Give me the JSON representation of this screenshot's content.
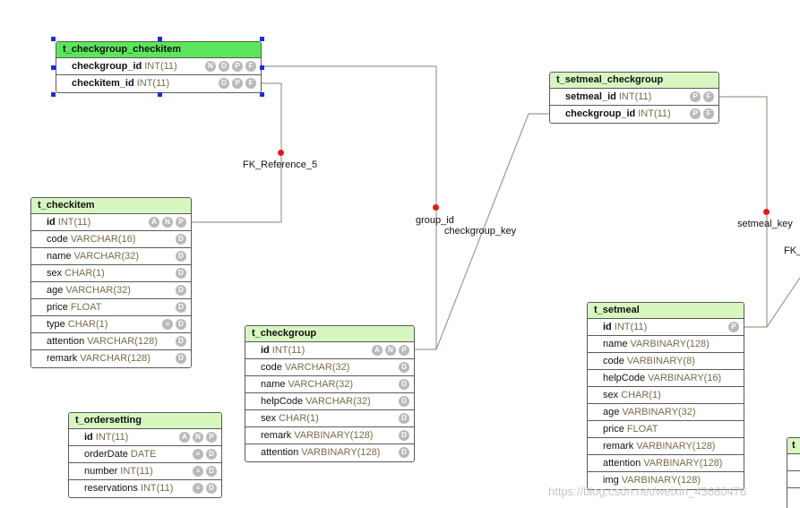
{
  "tables": {
    "checkgroup_checkitem": {
      "name": "t_checkgroup_checkitem",
      "columns": [
        {
          "name": "checkgroup_id",
          "type": "INT(11)",
          "pk": true,
          "flags": [
            "N",
            "D",
            "P",
            "F"
          ]
        },
        {
          "name": "checkitem_id",
          "type": "INT(11)",
          "pk": true,
          "flags": [
            "D",
            "P",
            "F"
          ]
        }
      ]
    },
    "setmeal_checkgroup": {
      "name": "t_setmeal_checkgroup",
      "columns": [
        {
          "name": "setmeal_id",
          "type": "INT(11)",
          "pk": true,
          "flags": [
            "P",
            "F"
          ]
        },
        {
          "name": "checkgroup_id",
          "type": "INT(11)",
          "pk": true,
          "flags": [
            "P",
            "F"
          ]
        }
      ]
    },
    "checkitem": {
      "name": "t_checkitem",
      "columns": [
        {
          "name": "id",
          "type": "INT(11)",
          "pk": true,
          "flags": [
            "A",
            "N",
            "P"
          ]
        },
        {
          "name": "code",
          "type": "VARCHAR(16)",
          "pk": false,
          "flags": [
            "D"
          ]
        },
        {
          "name": "name",
          "type": "VARCHAR(32)",
          "pk": false,
          "flags": [
            "D"
          ]
        },
        {
          "name": "sex",
          "type": "CHAR(1)",
          "pk": false,
          "flags": [
            "D"
          ]
        },
        {
          "name": "age",
          "type": "VARCHAR(32)",
          "pk": false,
          "flags": [
            "D"
          ]
        },
        {
          "name": "price",
          "type": "FLOAT",
          "pk": false,
          "flags": [
            "D"
          ]
        },
        {
          "name": "type",
          "type": "CHAR(1)",
          "pk": false,
          "flags": [
            "≡",
            "D"
          ]
        },
        {
          "name": "attention",
          "type": "VARCHAR(128)",
          "pk": false,
          "flags": [
            "D"
          ]
        },
        {
          "name": "remark",
          "type": "VARCHAR(128)",
          "pk": false,
          "flags": [
            "D"
          ]
        }
      ]
    },
    "checkgroup": {
      "name": "t_checkgroup",
      "columns": [
        {
          "name": "id",
          "type": "INT(11)",
          "pk": true,
          "flags": [
            "A",
            "N",
            "P"
          ]
        },
        {
          "name": "code",
          "type": "VARCHAR(32)",
          "pk": false,
          "flags": [
            "D"
          ]
        },
        {
          "name": "name",
          "type": "VARCHAR(32)",
          "pk": false,
          "flags": [
            "D"
          ]
        },
        {
          "name": "helpCode",
          "type": "VARCHAR(32)",
          "pk": false,
          "flags": [
            "D"
          ]
        },
        {
          "name": "sex",
          "type": "CHAR(1)",
          "pk": false,
          "flags": [
            "D"
          ]
        },
        {
          "name": "remark",
          "type": "VARBINARY(128)",
          "pk": false,
          "flags": [
            "D"
          ]
        },
        {
          "name": "attention",
          "type": "VARBINARY(128)",
          "pk": false,
          "flags": [
            "D"
          ]
        }
      ]
    },
    "ordersetting": {
      "name": "t_ordersetting",
      "columns": [
        {
          "name": "id",
          "type": "INT(11)",
          "pk": true,
          "flags": [
            "A",
            "N",
            "P"
          ]
        },
        {
          "name": "orderDate",
          "type": "DATE",
          "pk": false,
          "flags": [
            "≡",
            "D"
          ]
        },
        {
          "name": "number",
          "type": "INT(11)",
          "pk": false,
          "flags": [
            "≡",
            "D"
          ]
        },
        {
          "name": "reservations",
          "type": "INT(11)",
          "pk": false,
          "flags": [
            "≡",
            "D"
          ]
        }
      ]
    },
    "setmeal": {
      "name": "t_setmeal",
      "columns": [
        {
          "name": "id",
          "type": "INT(11)",
          "pk": true,
          "flags": [
            "P"
          ]
        },
        {
          "name": "name",
          "type": "VARBINARY(128)",
          "pk": false,
          "flags": []
        },
        {
          "name": "code",
          "type": "VARBINARY(8)",
          "pk": false,
          "flags": []
        },
        {
          "name": "helpCode",
          "type": "VARBINARY(16)",
          "pk": false,
          "flags": []
        },
        {
          "name": "sex",
          "type": "CHAR(1)",
          "pk": false,
          "flags": []
        },
        {
          "name": "age",
          "type": "VARBINARY(32)",
          "pk": false,
          "flags": []
        },
        {
          "name": "price",
          "type": "FLOAT",
          "pk": false,
          "flags": []
        },
        {
          "name": "remark",
          "type": "VARBINARY(128)",
          "pk": false,
          "flags": []
        },
        {
          "name": "attention",
          "type": "VARBINARY(128)",
          "pk": false,
          "flags": []
        },
        {
          "name": "img",
          "type": "VARBINARY(128)",
          "pk": false,
          "flags": []
        }
      ]
    }
  },
  "relations": {
    "fk_reference_5": "FK_Reference_5",
    "group_id": "group_id",
    "checkgroup_key": "checkgroup_key",
    "setmeal_key": "setmeal_key",
    "fk_partial": "FK_"
  },
  "partial_table_header": "t",
  "watermark": "https://blog.csdn.net/weixin_43660476",
  "colors": {
    "header": "#d8f6c0",
    "selected_header": "#5ce65c",
    "connector": "#a09a8e",
    "reference_dot": "#e81616",
    "selection_handle": "#1a2be8"
  }
}
